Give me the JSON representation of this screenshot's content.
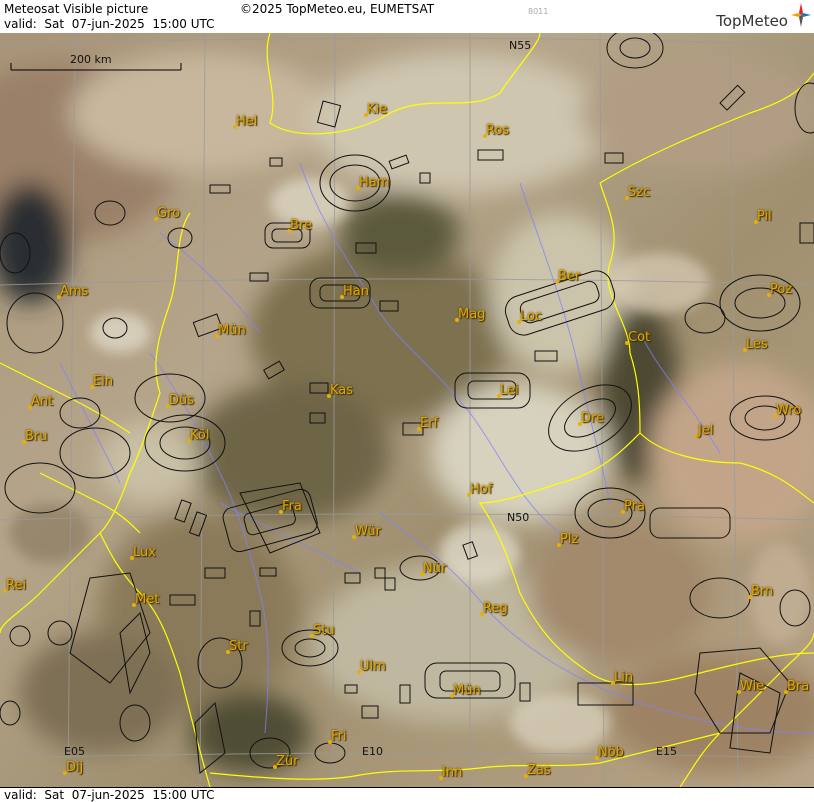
{
  "header": {
    "product": "Meteosat Visible picture",
    "valid": "valid:  Sat  07-jun-2025  15:00 UTC",
    "copyright": "©2025 TopMeteo.eu, EUMETSAT",
    "code": "8011",
    "brand": "TopMeteo"
  },
  "footer": {
    "valid": "valid:  Sat  07-jun-2025  15:00 UTC"
  },
  "scale": {
    "label": "200 km"
  },
  "grid": {
    "labels": [
      "N55",
      "N50",
      "E05",
      "E10",
      "E15"
    ]
  },
  "cities": [
    "Kie",
    "Hel",
    "Ros",
    "Ham",
    "Szc",
    "Gro",
    "Pil",
    "Bre",
    "Ber",
    "Ams",
    "Han",
    "Poz",
    "Mag",
    "Loc",
    "Mün",
    "Cot",
    "Les",
    "Ein",
    "Kas",
    "Lei",
    "Ant",
    "Düs",
    "Wro",
    "Dre",
    "Bru",
    "Köl",
    "Erf",
    "Jel",
    "Hof",
    "Fra",
    "Pra",
    "N50",
    "Lux",
    "Wür",
    "Plz",
    "Nür",
    "Rei",
    "Met",
    "Reg",
    "Brn",
    "Stu",
    "Str",
    "Ulm",
    "Lin",
    "Mün",
    "Wie",
    "Bra",
    "Fri",
    "Dij",
    "Zür",
    "Inn",
    "Zas",
    "Nöb"
  ],
  "colors": {
    "city": "#e0a800",
    "border": "#ffff00",
    "rivers": "#8080ff",
    "grid": "#9a9a9a"
  },
  "icons": [
    "compass-star-icon"
  ]
}
